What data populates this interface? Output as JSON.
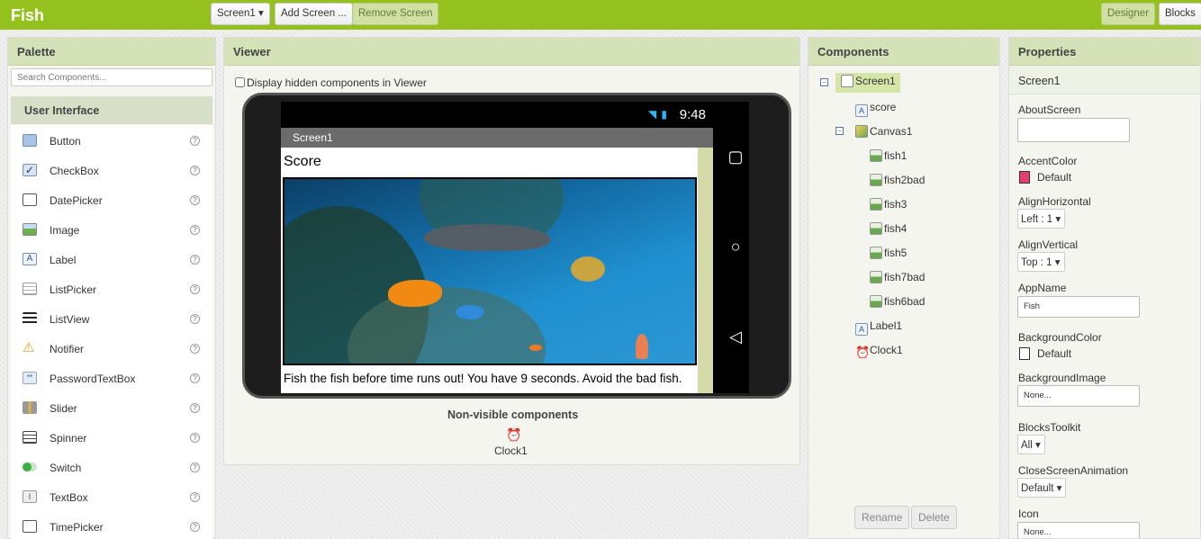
{
  "topbar": {
    "app_title": "Fish",
    "screen_select": "Screen1 ▾",
    "add_screen": "Add Screen ...",
    "remove_screen": "Remove Screen",
    "designer": "Designer",
    "blocks": "Blocks"
  },
  "palette": {
    "title": "Palette",
    "search_placeholder": "Search Components...",
    "group": "User Interface",
    "help_glyph": "?",
    "items": [
      {
        "label": "Button",
        "icon": "button-icon"
      },
      {
        "label": "CheckBox",
        "icon": "checkbox-icon"
      },
      {
        "label": "DatePicker",
        "icon": "datepicker-icon"
      },
      {
        "label": "Image",
        "icon": "image-icon"
      },
      {
        "label": "Label",
        "icon": "label-icon"
      },
      {
        "label": "ListPicker",
        "icon": "listpicker-icon"
      },
      {
        "label": "ListView",
        "icon": "listview-icon"
      },
      {
        "label": "Notifier",
        "icon": "notifier-icon"
      },
      {
        "label": "PasswordTextBox",
        "icon": "password-icon"
      },
      {
        "label": "Slider",
        "icon": "slider-icon"
      },
      {
        "label": "Spinner",
        "icon": "spinner-icon"
      },
      {
        "label": "Switch",
        "icon": "switch-icon"
      },
      {
        "label": "TextBox",
        "icon": "textbox-icon"
      },
      {
        "label": "TimePicker",
        "icon": "timepicker-icon"
      }
    ]
  },
  "viewer": {
    "title": "Viewer",
    "display_hidden": "Display hidden components in Viewer",
    "status_time": "9:48",
    "screen_title": "Screen1",
    "score_label": "Score",
    "info_label": "Fish the fish before time runs out! You have 9 seconds. Avoid the bad fish.",
    "nonvisible_title": "Non-visible components",
    "nonvisible_items": [
      "Clock1"
    ],
    "nav_square": "▢",
    "nav_circle": "○",
    "nav_back": "◁"
  },
  "components": {
    "title": "Components",
    "tree": {
      "screen": "Screen1",
      "score": "score",
      "canvas": "Canvas1",
      "sprites": [
        "fish1",
        "fish2bad",
        "fish3",
        "fish4",
        "fish5",
        "fish7bad",
        "fish6bad"
      ],
      "label": "Label1",
      "clock": "Clock1"
    },
    "rename": "Rename",
    "delete": "Delete"
  },
  "properties": {
    "title": "Properties",
    "component": "Screen1",
    "about_screen": {
      "name": "AboutScreen",
      "value": ""
    },
    "accent_color": {
      "name": "AccentColor",
      "value": "Default",
      "swatch": "#e63d6f"
    },
    "align_horizontal": {
      "name": "AlignHorizontal",
      "value": "Left : 1 ▾"
    },
    "align_vertical": {
      "name": "AlignVertical",
      "value": "Top : 1 ▾"
    },
    "app_name": {
      "name": "AppName",
      "value": "Fish"
    },
    "background_color": {
      "name": "BackgroundColor",
      "value": "Default",
      "swatch": "#ffffff"
    },
    "background_image": {
      "name": "BackgroundImage",
      "value": "None..."
    },
    "blocks_toolkit": {
      "name": "BlocksToolkit",
      "value": "All ▾"
    },
    "close_screen_animation": {
      "name": "CloseScreenAnimation",
      "value": "Default ▾"
    },
    "icon": {
      "name": "Icon",
      "value": "None..."
    }
  },
  "colors": {
    "brand_green": "#95c11f",
    "panel_head": "#d5e1b6",
    "selected": "#d6e6a9"
  }
}
